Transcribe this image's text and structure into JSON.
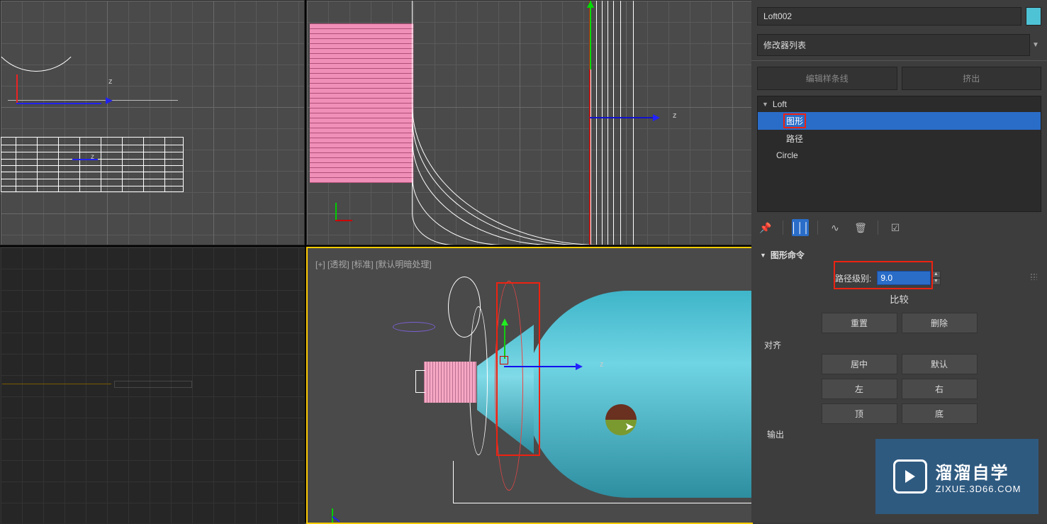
{
  "viewport_br_label": "[+] [透视] [标准] [默认明暗处理]",
  "axis_z": "z",
  "object_name": "Loft002",
  "modifier_list_label": "修改器列表",
  "mod_buttons": {
    "edit_spline": "编辑样条线",
    "extrude": "挤出"
  },
  "stack": {
    "header": "Loft",
    "shape": "图形",
    "path": "路径",
    "circle": "Circle"
  },
  "toolbar_icons": {
    "pin": "📌",
    "bars": "│││",
    "curve": "∿",
    "trash": "🗑",
    "config": "☑"
  },
  "rollout": {
    "title": "图形命令",
    "path_level_label": "路径级别:",
    "path_level_value": "9.0",
    "compare": "比较",
    "reset": "重置",
    "delete": "删除",
    "align_label": "对齐",
    "center": "居中",
    "default": "默认",
    "left": "左",
    "right": "右",
    "top": "顶",
    "bottom": "底",
    "output": "输出"
  },
  "watermark": {
    "title": "溜溜自学",
    "url": "ZIXUE.3D66.COM"
  }
}
